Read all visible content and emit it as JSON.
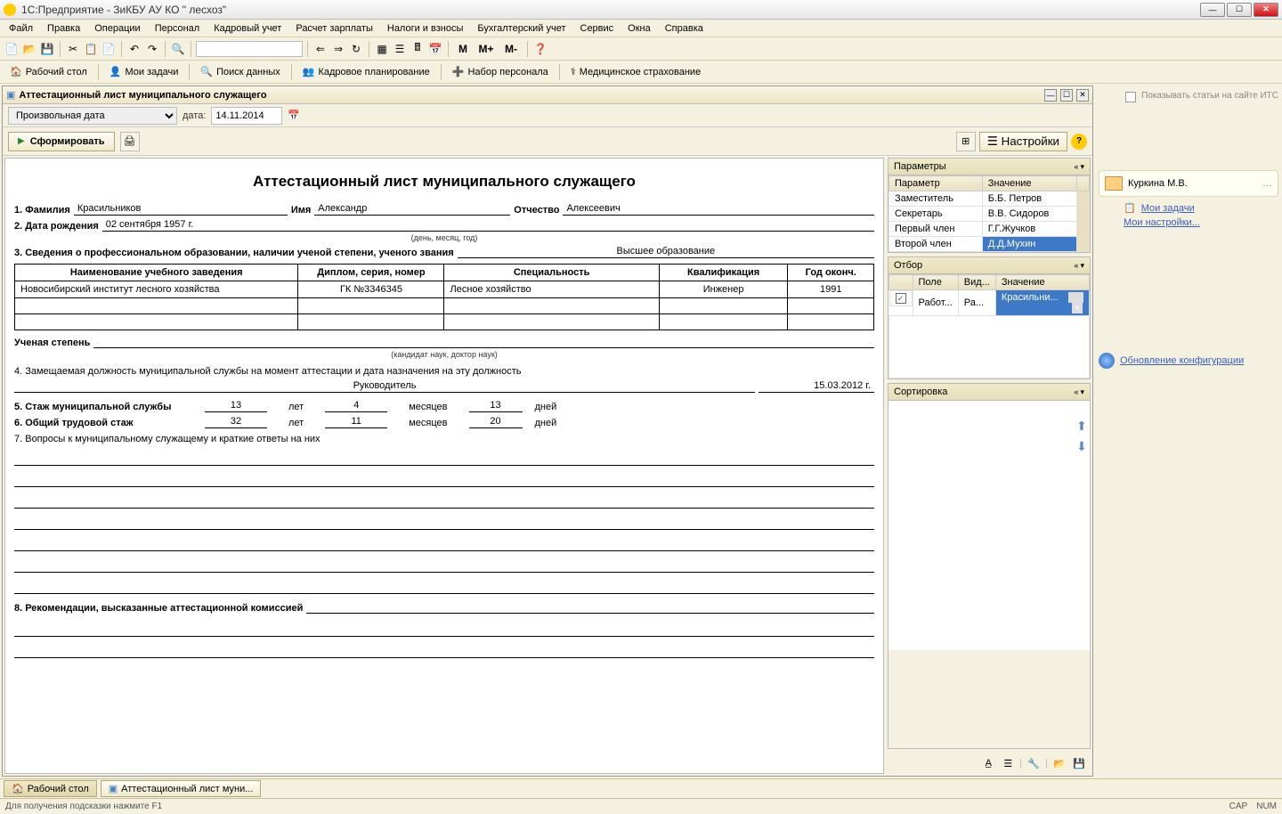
{
  "window": {
    "title": "1С:Предприятие - ЗиКБУ АУ КО \"                       лесхоз\""
  },
  "menu": [
    "Файл",
    "Правка",
    "Операции",
    "Персонал",
    "Кадровый учет",
    "Расчет зарплаты",
    "Налоги и взносы",
    "Бухгалтерский учет",
    "Сервис",
    "Окна",
    "Справка"
  ],
  "toolbar2": {
    "desktop": "Рабочий стол",
    "tasks": "Мои задачи",
    "search": "Поиск данных",
    "m_labels": [
      "M",
      "M+",
      "M-"
    ],
    "staff_planning": "Кадровое планирование",
    "recruitment": "Набор персонала",
    "med_insurance": "Медицинское страхование"
  },
  "doc": {
    "title": "Аттестационный лист муниципального служащего",
    "date_mode": "Произвольная дата",
    "date_label": "дата:",
    "date_value": "14.11.2014",
    "form_btn": "Сформировать",
    "settings_btn": "Настройки"
  },
  "report": {
    "title": "Аттестационный лист муниципального служащего",
    "row1": {
      "fam_lbl": "1. Фамилия",
      "fam": "Красильников",
      "name_lbl": "Имя",
      "name": "Александр",
      "patr_lbl": "Отчество",
      "patr": "Алексеевич"
    },
    "row2": {
      "lbl": "2. Дата рождения",
      "value": "02 сентября 1957 г.",
      "caption": "(день, месяц, год)"
    },
    "row3": {
      "lbl": "3. Сведения о профессиональном образовании, наличии ученой степени, ученого звания",
      "value": "Высшее образование"
    },
    "edu_headers": [
      "Наименование учебного заведения",
      "Диплом, серия, номер",
      "Специальность",
      "Квалификация",
      "Год оконч."
    ],
    "edu_rows": [
      [
        "Новосибирский институт лесного хозяйства",
        "ГК №3346345",
        "Лесное хозяйство",
        "Инженер",
        "1991"
      ]
    ],
    "degree_lbl": "Ученая степень",
    "degree_caption": "(кандидат наук, доктор наук)",
    "row4_lbl": "4. Замещаемая должность муниципальной службы на момент аттестации и дата назначения на эту должность",
    "row4_position": "Руководитель",
    "row4_date": "15.03.2012 г.",
    "row5": {
      "lbl": "5. Стаж муниципальной службы",
      "years": "13",
      "y_lbl": "лет",
      "months": "4",
      "m_lbl": "месяцев",
      "days": "13",
      "d_lbl": "дней"
    },
    "row6": {
      "lbl": "6. Общий трудовой стаж",
      "years": "32",
      "y_lbl": "лет",
      "months": "11",
      "m_lbl": "месяцев",
      "days": "20",
      "d_lbl": "дней"
    },
    "row7_lbl": "7. Вопросы к муниципальному служащему и краткие ответы на них",
    "row8_lbl": "8. Рекомендации, высказанные аттестационной комиссией"
  },
  "params": {
    "header": "Параметры",
    "col_param": "Параметр",
    "col_value": "Значение",
    "rows": [
      {
        "p": "Заместитель",
        "v": "Б.Б. Петров"
      },
      {
        "p": "Секретарь",
        "v": "В.В. Сидоров"
      },
      {
        "p": "Первый член",
        "v": "Г.Г.Жучков"
      },
      {
        "p": "Второй член",
        "v": "Д.Д.Мухин"
      }
    ]
  },
  "filter": {
    "header": "Отбор",
    "col_field": "Поле",
    "col_type": "Вид...",
    "col_value": "Значение",
    "row": {
      "field": "Работ...",
      "type": "Ра...",
      "value": "Красильни..."
    }
  },
  "sort": {
    "header": "Сортировка"
  },
  "sidebar": {
    "show_articles": "Показывать статьи на сайте ИТС",
    "user": "Куркина М.В.",
    "my_tasks": "Мои задачи",
    "my_settings": "Мои настройки...",
    "update": "Обновление конфигурации"
  },
  "tabs": {
    "desktop": "Рабочий стол",
    "doc": "Аттестационный лист муни..."
  },
  "status": {
    "hint": "Для получения подсказки нажмите F1",
    "cap": "CAP",
    "num": "NUM"
  }
}
